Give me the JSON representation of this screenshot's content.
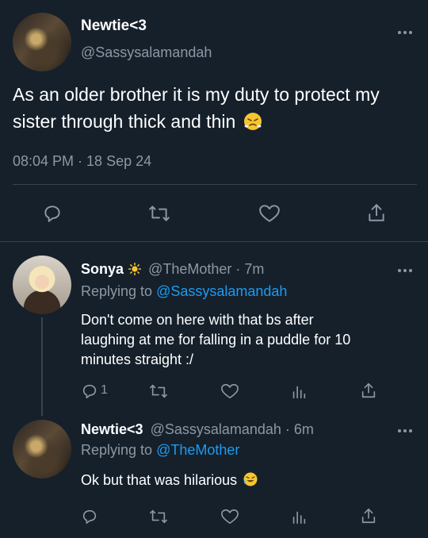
{
  "main_tweet": {
    "display_name": "Newtie<3",
    "handle": "@Sassysalamandah",
    "text": "As an older brother it is my duty to protect my sister through thick and thin",
    "emoji": "😤",
    "time": "08:04 PM · 18 Sep 24"
  },
  "reply1": {
    "display_name": "Sonya",
    "name_emoji": "☀️",
    "handle_time": "@TheMother · 7m",
    "replying_prefix": "Replying to ",
    "replying_handle": "@Sassysalamandah",
    "line1": "Don't come on here with that bs after",
    "line2": "laughing at me for falling in a puddle for 10",
    "line3": "minutes straight :/",
    "reply_count": "1"
  },
  "reply2": {
    "display_name": "Newtie<3",
    "handle_time": "@Sassysalamandah · 6m",
    "replying_prefix": "Replying to ",
    "replying_handle": "@TheMother",
    "text": "Ok but that was hilarious",
    "emoji": "🤣"
  },
  "colors": {
    "background": "#15202b",
    "text": "#ffffff",
    "muted": "#8b98a5",
    "link": "#1d9bf0",
    "divider": "#38444d"
  },
  "icons": [
    "reply-icon",
    "retweet-icon",
    "like-icon",
    "share-icon",
    "analytics-icon",
    "more-icon"
  ]
}
